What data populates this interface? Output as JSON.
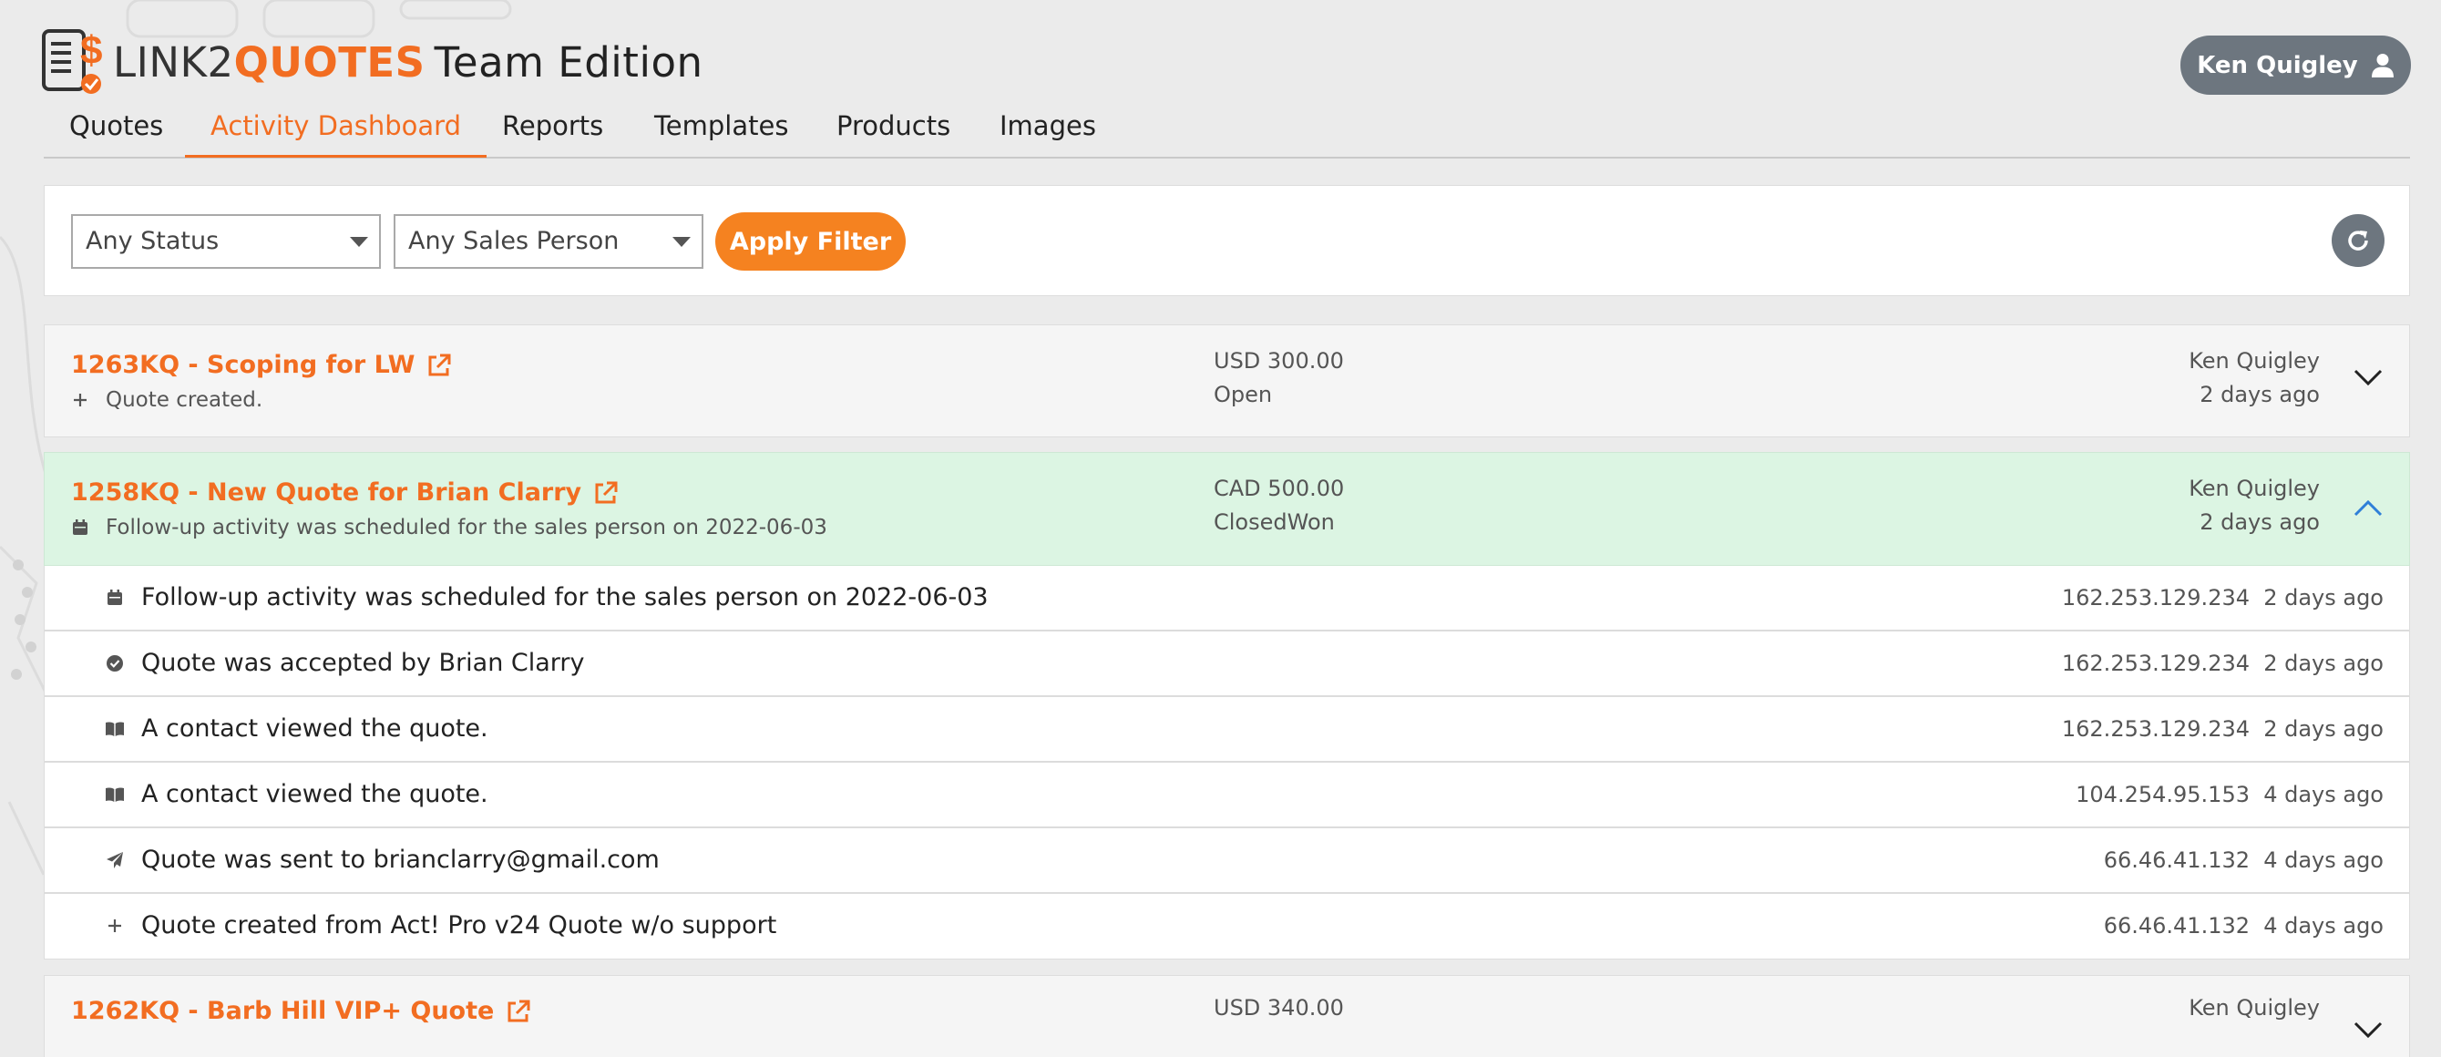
{
  "brand": {
    "name_prefix": "LINK2",
    "name_highlight": "QUOTES",
    "edition": "Team Edition"
  },
  "user": {
    "name": "Ken Quigley",
    "icon": "user-icon"
  },
  "nav": {
    "tabs": [
      {
        "label": "Quotes",
        "active": false
      },
      {
        "label": "Activity Dashboard",
        "active": true
      },
      {
        "label": "Reports",
        "active": false
      },
      {
        "label": "Templates",
        "active": false
      },
      {
        "label": "Products",
        "active": false
      },
      {
        "label": "Images",
        "active": false
      }
    ]
  },
  "filters": {
    "status_select": "Any Status",
    "salesperson_select": "Any Sales Person",
    "apply_label": "Apply Filter",
    "refresh_icon": "refresh-icon"
  },
  "quotes": [
    {
      "title": "1263KQ - Scoping for LW",
      "latest_activity": "Quote created.",
      "latest_icon": "plus-icon",
      "amount": "USD 300.00",
      "status": "Open",
      "salesperson": "Ken Quigley",
      "when": "2 days ago",
      "expanded": false
    },
    {
      "title": "1258KQ - New Quote for Brian Clarry",
      "latest_activity": "Follow-up activity was scheduled for the sales person on 2022-06-03",
      "latest_icon": "calendar-icon",
      "amount": "CAD 500.00",
      "status": "ClosedWon",
      "salesperson": "Ken Quigley",
      "when": "2 days ago",
      "expanded": true,
      "activities": [
        {
          "icon": "calendar-icon",
          "text": "Follow-up activity was scheduled for the sales person on 2022-06-03",
          "ip": "162.253.129.234",
          "when": "2 days ago"
        },
        {
          "icon": "check-circle-icon",
          "text": "Quote was accepted by Brian Clarry",
          "ip": "162.253.129.234",
          "when": "2 days ago"
        },
        {
          "icon": "book-open-icon",
          "text": "A contact viewed the quote.",
          "ip": "162.253.129.234",
          "when": "2 days ago"
        },
        {
          "icon": "book-open-icon",
          "text": "A contact viewed the quote.",
          "ip": "104.254.95.153",
          "when": "4 days ago"
        },
        {
          "icon": "paper-plane-icon",
          "text": "Quote was sent to brianclarry@gmail.com",
          "ip": "66.46.41.132",
          "when": "4 days ago"
        },
        {
          "icon": "plus-icon",
          "text": "Quote created from Act! Pro v24 Quote w/o support",
          "ip": "66.46.41.132",
          "when": "4 days ago"
        }
      ]
    },
    {
      "title": "1262KQ - Barb Hill VIP+ Quote",
      "amount": "USD 340.00",
      "salesperson": "Ken Quigley",
      "expanded": false
    }
  ],
  "colors": {
    "accent": "#f26d21",
    "button_orange": "#f58220",
    "expanded_row": "#dcf5e3",
    "gray_button": "#6d767f"
  }
}
